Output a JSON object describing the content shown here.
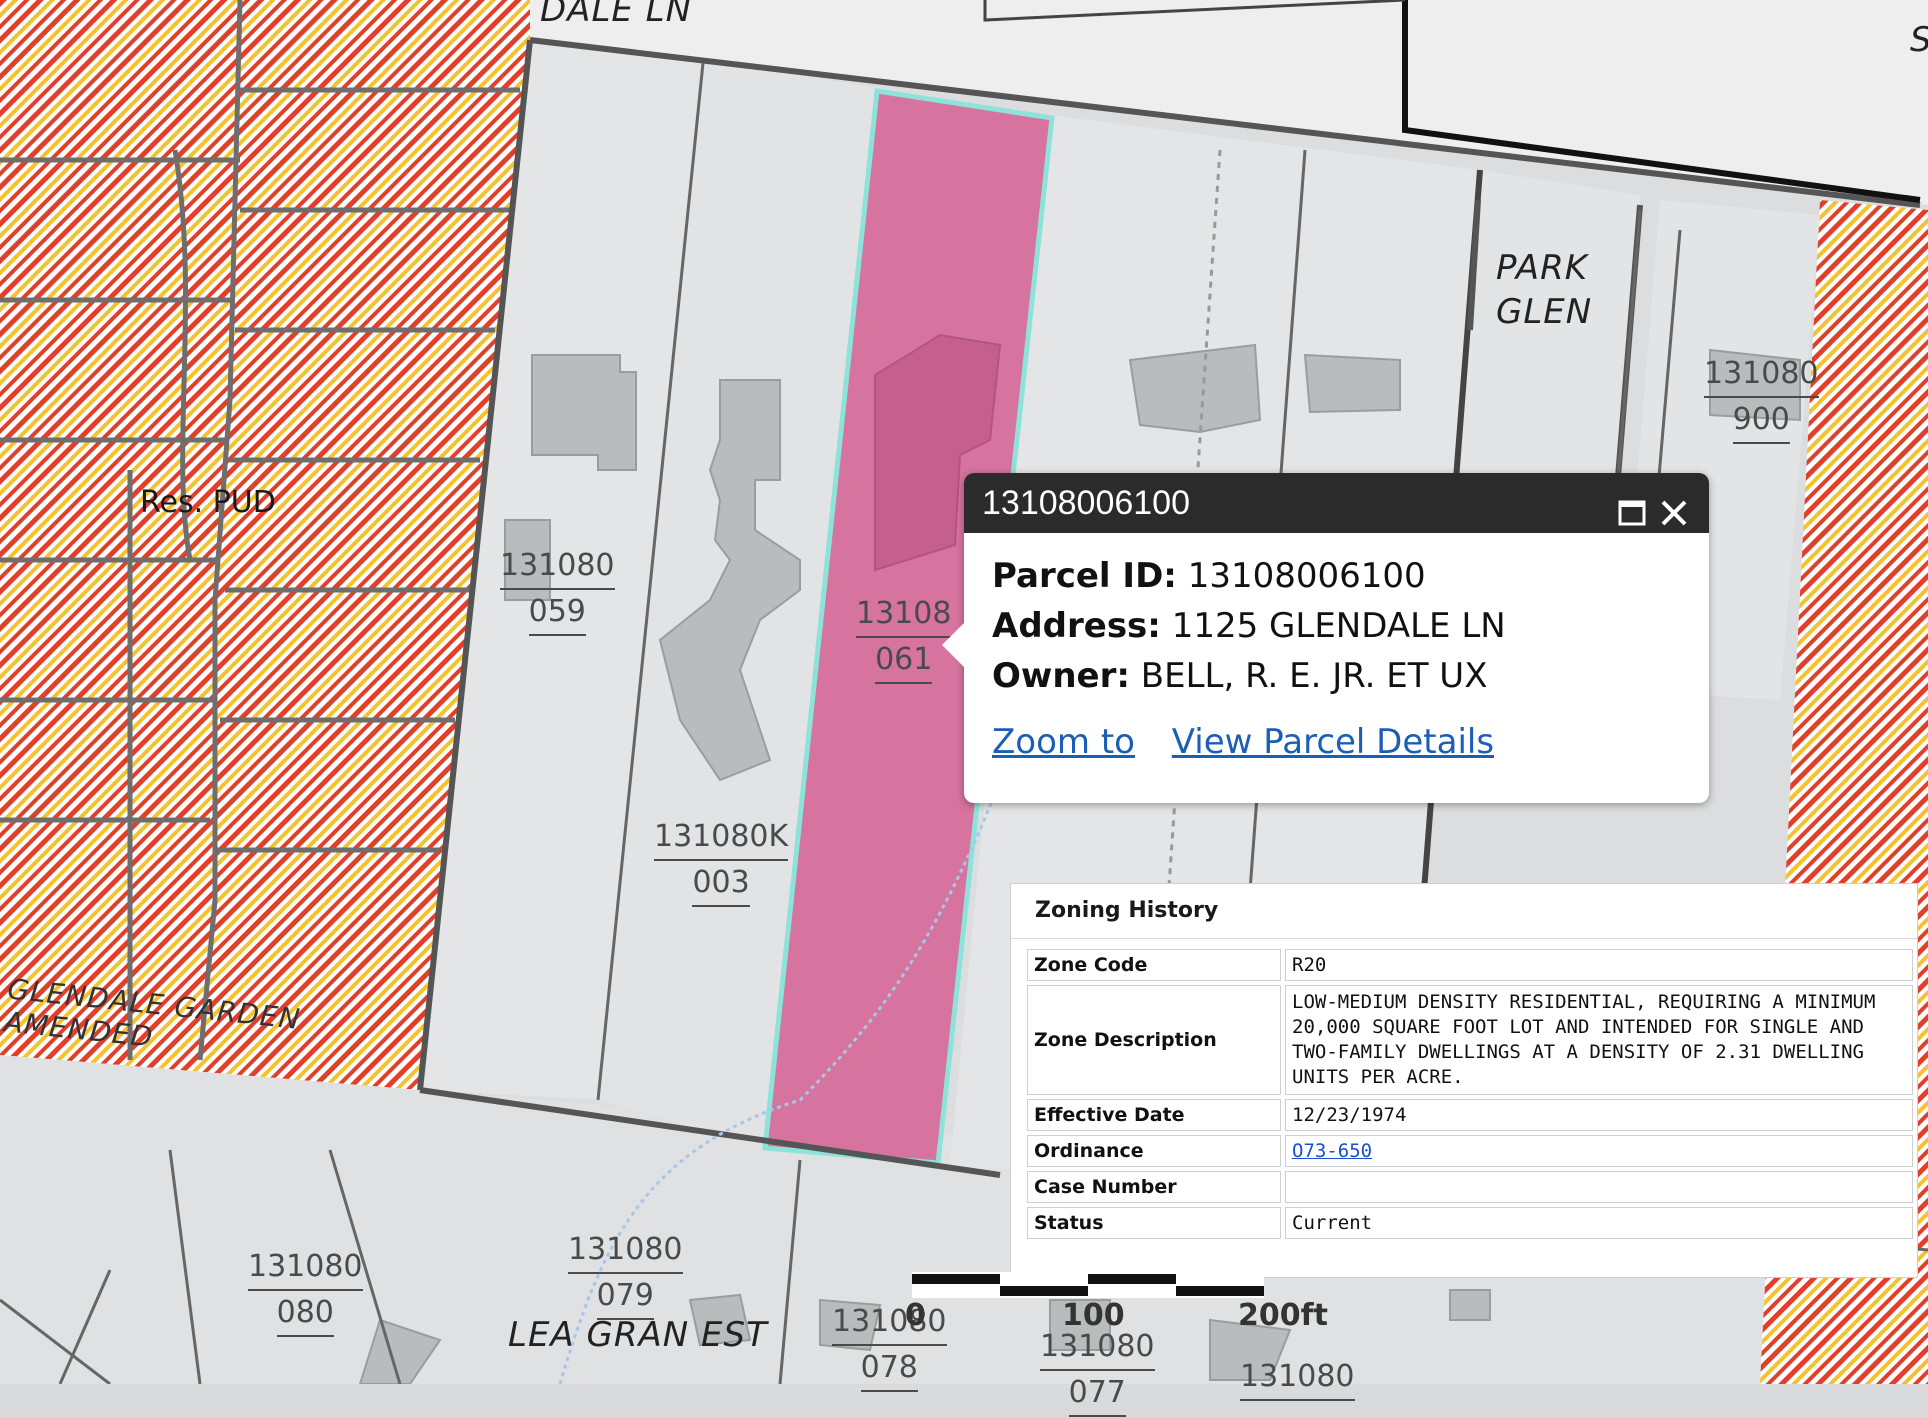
{
  "map": {
    "street_top": "DALE LN",
    "street_bottom": "LEA GRAN EST",
    "subdivision": "PARK\nGLEN",
    "subdivision_line1": "PARK",
    "subdivision_line2": "GLEN",
    "zoning_label": "Res. PUD",
    "subdivision_left": "GLENDALE GARDEN AMENDED",
    "corner_letter": "S",
    "parcels": [
      {
        "line1": "131080",
        "line2": "059"
      },
      {
        "line1": "13108",
        "line2": "061"
      },
      {
        "line1": "131080K",
        "line2": "003"
      },
      {
        "line1": "131080",
        "line2": "900"
      },
      {
        "line1": "131080",
        "line2": "080"
      },
      {
        "line1": "131080",
        "line2": "079"
      },
      {
        "line1": "131080",
        "line2": "078"
      },
      {
        "line1": "131080",
        "line2": "077"
      },
      {
        "line1": "131080",
        "line2": ""
      }
    ],
    "colors": {
      "selected_fill": "#d6739f",
      "selected_outline": "#8de3d9",
      "hatch_red": "#e0402a",
      "hatch_yellow": "#f2c230",
      "parcel_fill": "#e3e4e5",
      "building": "#b9bcbd"
    }
  },
  "popup": {
    "title": "13108006100",
    "maximize_icon": "maximize-icon",
    "close_icon": "close-icon",
    "parcel_id_label": "Parcel ID:",
    "parcel_id": "13108006100",
    "address_label": "Address:",
    "address": "1125 GLENDALE LN",
    "owner_label": "Owner:",
    "owner": "BELL, R. E. JR. ET UX",
    "links": [
      "Zoom to",
      "View Parcel Details"
    ]
  },
  "zoning": {
    "title": "Zoning History",
    "rows": [
      {
        "key": "Zone Code",
        "value": "R20"
      },
      {
        "key": "Zone Description",
        "value": "LOW-MEDIUM DENSITY RESIDENTIAL, REQUIRING A MINIMUM 20,000 SQUARE FOOT LOT AND INTENDED FOR SINGLE AND TWO-FAMILY DWELLINGS AT A DENSITY OF 2.31 DWELLING UNITS PER ACRE."
      },
      {
        "key": "Effective Date",
        "value": "12/23/1974"
      },
      {
        "key": "Ordinance",
        "value": "O73-650"
      },
      {
        "key": "Case Number",
        "value": ""
      },
      {
        "key": "Status",
        "value": "Current"
      }
    ]
  },
  "scale": {
    "labels": [
      "0",
      "100",
      "200ft"
    ]
  }
}
